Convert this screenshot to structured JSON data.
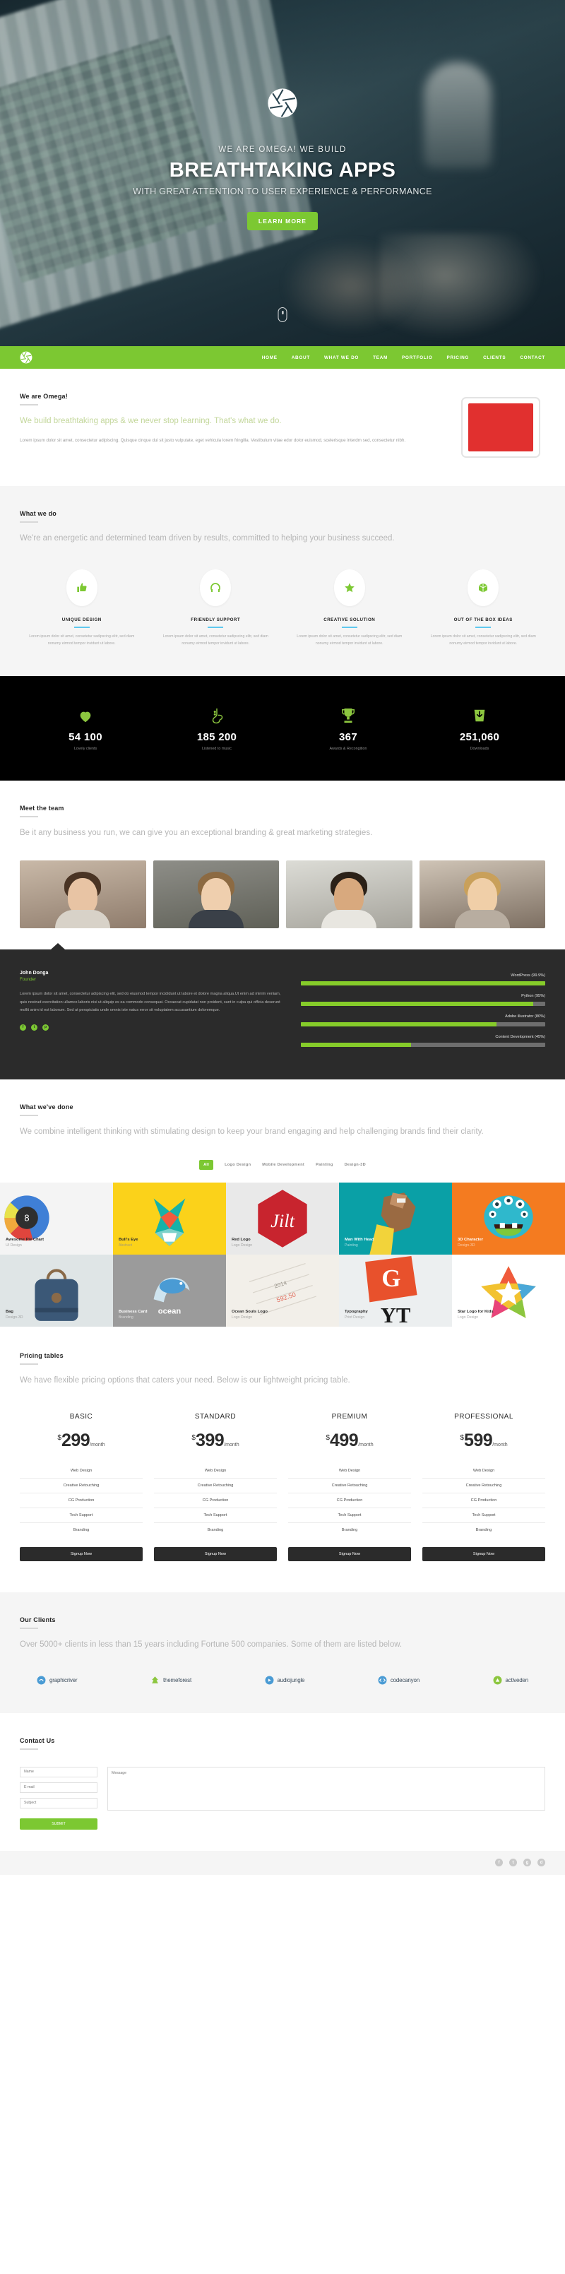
{
  "hero": {
    "logo_icon": "aperture-icon",
    "kicker": "WE ARE OMEGA! WE BUILD",
    "title": "BREATHTAKING APPS",
    "subtitle": "WITH GREAT ATTENTION TO USER EXPERIENCE & PERFORMANCE",
    "cta": "LEARN MORE",
    "scroll_icon": "mouse-scroll-icon"
  },
  "nav": {
    "logo_icon": "aperture-icon",
    "accent": "#7cc832",
    "items": [
      {
        "label": "HOME"
      },
      {
        "label": "ABOUT"
      },
      {
        "label": "WHAT WE DO"
      },
      {
        "label": "TEAM"
      },
      {
        "label": "PORTFOLIO"
      },
      {
        "label": "PRICING"
      },
      {
        "label": "CLIENTS"
      },
      {
        "label": "CONTACT"
      }
    ]
  },
  "about": {
    "heading": "We are Omega!",
    "lead": "We build breathtaking apps & we never stop learning. That's what we do.",
    "body": "Lorem ipsum dolor sit amet, consectetur adipiscing. Quisque cinque dui sit justo vulputate, eget vehicula lorem fringilla. Vestibulum vitae edor dolor euismod, scelerisque interdm sed, consectetur nibh.",
    "device_icon": "tablet-icon"
  },
  "whatwedo": {
    "heading": "What we do",
    "lead": "We're an energetic and determined team driven by results, committed to helping your business succeed.",
    "features": [
      {
        "icon": "thumbs-up-icon",
        "title": "UNIQUE DESIGN",
        "copy": "Lorem ipsum dolor sit amet, consetetur sadipscing elitr, sed diam nonumy eirmod tempor invidunt ut labore."
      },
      {
        "icon": "headphones-icon",
        "title": "FRIENDLY SUPPORT",
        "copy": "Lorem ipsum dolor sit amet, consetetur sadipscing elitr, sed diam nonumy eirmod tempor invidunt ut labore."
      },
      {
        "icon": "star-icon",
        "title": "CREATIVE SOLUTION",
        "copy": "Lorem ipsum dolor sit amet, consetetur sadipscing elitr, sed diam nonumy eirmod tempor invidunt ut labore."
      },
      {
        "icon": "box-icon",
        "title": "OUT OF THE BOX IDEAS",
        "copy": "Lorem ipsum dolor sit amet, consetetur sadipscing elitr, sed diam nonumy eirmod tempor invidunt ut labore."
      }
    ]
  },
  "stats": [
    {
      "icon": "heart-icon",
      "value": "54 100",
      "label": "Lovely clients"
    },
    {
      "icon": "saxophone-icon",
      "value": "185 200",
      "label": "Listened to music"
    },
    {
      "icon": "trophy-icon",
      "value": "367",
      "label": "Awards & Recongition"
    },
    {
      "icon": "download-bag-icon",
      "value": "251,060",
      "label": "Downloads"
    }
  ],
  "team": {
    "heading": "Meet the team",
    "lead": "Be it any business you run, we can give you an exceptional branding & great marketing strategies.",
    "members": [
      {
        "name": "team-member-1"
      },
      {
        "name": "team-member-2"
      },
      {
        "name": "team-member-3"
      },
      {
        "name": "team-member-4"
      }
    ]
  },
  "testimonial": {
    "name": "John Donga",
    "role": "Founder",
    "text": "Lorem ipsum dolor sit amet, consectetur adipiscing elit, sed do eiusmod tempor incididunt ut labore et dolore magna aliqua.Ut enim ad minim veniam, quis nostrud exercitation ullamco laboris nisi ut aliquip ex ea commodo consequat. Occaecat cupidatat non proident, sunt in culpa qui officia deserunt mollit anim id est laborum. Sed ut perspiciatis unde omnis iste natus error sit voluptatem accusantium doloremque.",
    "social": [
      {
        "icon": "facebook-icon",
        "glyph": "f"
      },
      {
        "icon": "twitter-icon",
        "glyph": "t"
      },
      {
        "icon": "pinterest-icon",
        "glyph": "p"
      }
    ],
    "skills": [
      {
        "label": "WordPress (99.9%)",
        "value": 99.9
      },
      {
        "label": "Python (95%)",
        "value": 95
      },
      {
        "label": "Adobe illustrator (80%)",
        "value": 80
      },
      {
        "label": "Content Development (45%)",
        "value": 45
      }
    ]
  },
  "portfolio": {
    "heading": "What we've done",
    "lead": "We combine intelligent thinking with stimulating design to keep your brand engaging and help challenging brands find their clarity.",
    "filters": [
      {
        "label": "All",
        "active": true
      },
      {
        "label": "Logo Design",
        "active": false
      },
      {
        "label": "Mobile Development",
        "active": false
      },
      {
        "label": "Painting",
        "active": false
      },
      {
        "label": "Design-3D",
        "active": false
      }
    ],
    "items": [
      {
        "title": "Awesome Pie Chart",
        "category": "UI Design"
      },
      {
        "title": "Bull's Eye",
        "category": "Abstract"
      },
      {
        "title": "Red Logo",
        "category": "Logo Design"
      },
      {
        "title": "Man With Head",
        "category": "Painting"
      },
      {
        "title": "3D Character",
        "category": "Design-3D"
      },
      {
        "title": "Bag",
        "category": "Design-3D"
      },
      {
        "title": "Business Card",
        "category": "Branding"
      },
      {
        "title": "Ocean Souls Logo",
        "category": "Logo Design"
      },
      {
        "title": "Typography",
        "category": "Print Design"
      },
      {
        "title": "Star Logo for Kids",
        "category": "Logo Design"
      }
    ]
  },
  "pricing": {
    "heading": "Pricing tables",
    "lead": "We have flexible pricing options that caters your need. Below is our lightweight pricing table.",
    "plans": [
      {
        "name": "BASIC",
        "currency": "$",
        "amount": "299",
        "period": "/month",
        "features": [
          "Web Design",
          "Creative Retouching",
          "CG Production",
          "Tech Support",
          "Branding"
        ],
        "cta": "Signup Now"
      },
      {
        "name": "STANDARD",
        "currency": "$",
        "amount": "399",
        "period": "/month",
        "features": [
          "Web Design",
          "Creative Retouching",
          "CG Production",
          "Tech Support",
          "Branding"
        ],
        "cta": "Signup Now"
      },
      {
        "name": "PREMIUM",
        "currency": "$",
        "amount": "499",
        "period": "/month",
        "features": [
          "Web Design",
          "Creative Retouching",
          "CG Production",
          "Tech Support",
          "Branding"
        ],
        "cta": "Signup Now"
      },
      {
        "name": "PROFESSIONAL",
        "currency": "$",
        "amount": "599",
        "period": "/month",
        "features": [
          "Web Design",
          "Creative Retouching",
          "CG Production",
          "Tech Support",
          "Branding"
        ],
        "cta": "Signup Now"
      }
    ]
  },
  "clients": {
    "heading": "Our Clients",
    "lead": "Over 5000+ clients in less than 15 years including Fortune 500 companies. Some of them are listed below.",
    "logos": [
      {
        "name": "graphicriver",
        "icon": "graphicriver-icon",
        "color": "#4a9bd4"
      },
      {
        "name": "themeforest",
        "icon": "themeforest-icon",
        "color": "#8cc63f"
      },
      {
        "name": "audiojungle",
        "icon": "audiojungle-icon",
        "color": "#4a9bd4"
      },
      {
        "name": "codecanyon",
        "icon": "codecanyon-icon",
        "color": "#4a9bd4"
      },
      {
        "name": "activeden",
        "icon": "activeden-icon",
        "color": "#8cc63f"
      }
    ]
  },
  "contact": {
    "heading": "Contact Us",
    "fields": [
      {
        "name": "name-field",
        "placeholder": "Name"
      },
      {
        "name": "email-field",
        "placeholder": "E-mail"
      },
      {
        "name": "subject-field",
        "placeholder": "Subject"
      }
    ],
    "message_placeholder": "Message",
    "submit": "SUBMIT"
  },
  "footer": {
    "social": [
      {
        "icon": "facebook-icon",
        "glyph": "f"
      },
      {
        "icon": "twitter-icon",
        "glyph": "t"
      },
      {
        "icon": "google-plus-icon",
        "glyph": "g"
      },
      {
        "icon": "dribbble-icon",
        "glyph": "d"
      }
    ]
  }
}
